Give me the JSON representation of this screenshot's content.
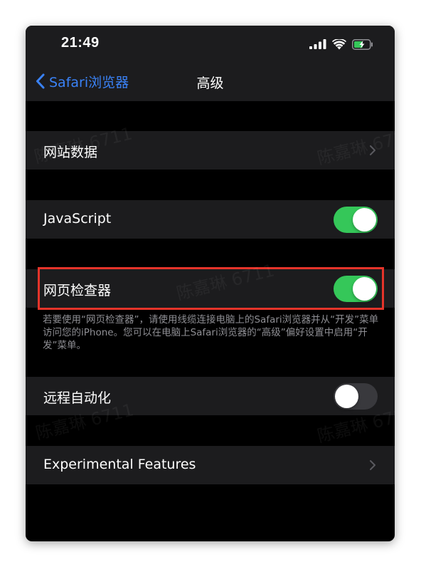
{
  "status_bar": {
    "time": "21:49",
    "icons": [
      "cellular-signal-icon",
      "wifi-icon",
      "battery-charging-icon"
    ]
  },
  "nav": {
    "back_label": "Safari浏览器",
    "title": "高级"
  },
  "rows": {
    "website_data": {
      "label": "网站数据"
    },
    "javascript": {
      "label": "JavaScript",
      "enabled": true
    },
    "web_inspector": {
      "label": "网页检查器",
      "enabled": true
    },
    "remote_automation": {
      "label": "远程自动化",
      "enabled": false
    },
    "experimental_features": {
      "label": "Experimental Features"
    }
  },
  "web_inspector_footnote": "若要使用“网页检查器”，请使用线缆连接电脑上的Safari浏览器并从“开发”菜单访问您的iPhone。您可以在电脑上Safari浏览器的“高级”偏好设置中启用“开发”菜单。",
  "watermark": "陈嘉琳 6711",
  "colors": {
    "background": "#000000",
    "cell_background": "#1c1c1e",
    "accent_blue": "#3a82f7",
    "toggle_on": "#35c759",
    "toggle_off": "#39393d",
    "highlight_red": "#e5342a",
    "footnote_gray": "#8e8e93"
  }
}
